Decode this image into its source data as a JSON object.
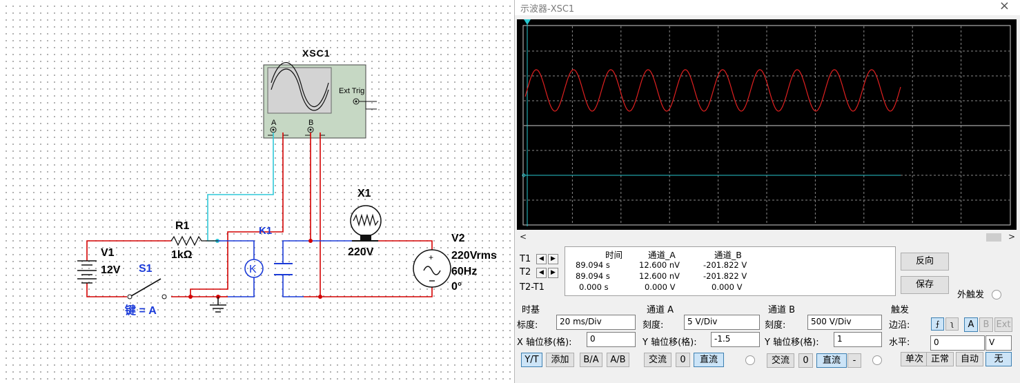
{
  "circuit": {
    "scope_name": "XSC1",
    "scope_ext_trig": "Ext Trig",
    "scope_ch_a": "A",
    "scope_ch_b": "B",
    "r1_name": "R1",
    "r1_value": "1kΩ",
    "k1_name": "K1",
    "k1_symbol": "K",
    "x1_name": "X1",
    "x1_value": "220V",
    "v1_name": "V1",
    "v1_value": "12V",
    "s1_name": "S1",
    "s1_key": "键 = A",
    "v2_name": "V2",
    "v2_rms": "220Vrms",
    "v2_freq": "60Hz",
    "v2_phase": "0°",
    "colors": {
      "wire_red": "#d40000",
      "wire_cyan": "#2ec8d8",
      "wire_blue": "#1a3ad8",
      "label_blue": "#1a3ad8"
    }
  },
  "scope": {
    "title": "示波器-XSC1",
    "close_icon": "×",
    "readout": {
      "headers": [
        "时间",
        "通道_A",
        "通道_B"
      ],
      "rows": [
        {
          "label": "T1",
          "time": "89.094 s",
          "a": "12.600 nV",
          "b": "-201.822 V"
        },
        {
          "label": "T2",
          "time": "89.094 s",
          "a": "12.600 nV",
          "b": "-201.822 V"
        },
        {
          "label": "T2-T1",
          "time": "0.000 s",
          "a": "0.000 V",
          "b": "0.000 V"
        }
      ]
    },
    "buttons": {
      "reverse": "反向",
      "save": "保存",
      "ext_trigger": "外触发"
    },
    "timebase": {
      "title": "时基",
      "scale_label": "标度:",
      "scale_value": "20 ms/Div",
      "xpos_label": "X 轴位移(格):",
      "xpos_value": "0",
      "modes": [
        "Y/T",
        "添加",
        "B/A",
        "A/B"
      ],
      "active_mode": "Y/T"
    },
    "channel_a": {
      "title": "通道 A",
      "scale_label": "刻度:",
      "scale_value": "5  V/Div",
      "ypos_label": "Y 轴位移(格):",
      "ypos_value": "-1.5",
      "coupling": [
        "交流",
        "0",
        "直流"
      ],
      "active": "直流"
    },
    "channel_b": {
      "title": "通道 B",
      "scale_label": "刻度:",
      "scale_value": "500  V/Div",
      "ypos_label": "Y 轴位移(格):",
      "ypos_value": "1",
      "coupling": [
        "交流",
        "0",
        "直流",
        "-"
      ],
      "active": "直流"
    },
    "trigger": {
      "title": "触发",
      "edge_label": "边沿:",
      "edge_buttons": [
        "A",
        "B",
        "Ext"
      ],
      "level_label": "水平:",
      "level_value": "0",
      "level_unit": "V",
      "modes": [
        "单次",
        "正常",
        "自动",
        "无"
      ],
      "active_mode": "无"
    },
    "colors": {
      "trace_a": "#e02020",
      "trace_b": "#28c8d0",
      "screen": "#000000",
      "grid": "#9a9a9a"
    }
  }
}
